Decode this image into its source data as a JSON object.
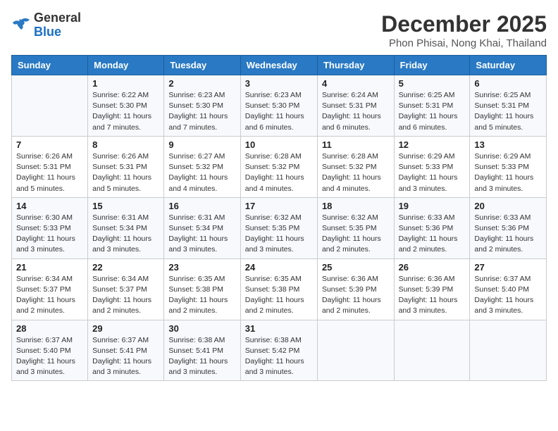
{
  "logo": {
    "general": "General",
    "blue": "Blue"
  },
  "title": "December 2025",
  "location": "Phon Phisai, Nong Khai, Thailand",
  "weekdays": [
    "Sunday",
    "Monday",
    "Tuesday",
    "Wednesday",
    "Thursday",
    "Friday",
    "Saturday"
  ],
  "weeks": [
    [
      {
        "day": "",
        "info": ""
      },
      {
        "day": "1",
        "info": "Sunrise: 6:22 AM\nSunset: 5:30 PM\nDaylight: 11 hours\nand 7 minutes."
      },
      {
        "day": "2",
        "info": "Sunrise: 6:23 AM\nSunset: 5:30 PM\nDaylight: 11 hours\nand 7 minutes."
      },
      {
        "day": "3",
        "info": "Sunrise: 6:23 AM\nSunset: 5:30 PM\nDaylight: 11 hours\nand 6 minutes."
      },
      {
        "day": "4",
        "info": "Sunrise: 6:24 AM\nSunset: 5:31 PM\nDaylight: 11 hours\nand 6 minutes."
      },
      {
        "day": "5",
        "info": "Sunrise: 6:25 AM\nSunset: 5:31 PM\nDaylight: 11 hours\nand 6 minutes."
      },
      {
        "day": "6",
        "info": "Sunrise: 6:25 AM\nSunset: 5:31 PM\nDaylight: 11 hours\nand 5 minutes."
      }
    ],
    [
      {
        "day": "7",
        "info": "Sunrise: 6:26 AM\nSunset: 5:31 PM\nDaylight: 11 hours\nand 5 minutes."
      },
      {
        "day": "8",
        "info": "Sunrise: 6:26 AM\nSunset: 5:31 PM\nDaylight: 11 hours\nand 5 minutes."
      },
      {
        "day": "9",
        "info": "Sunrise: 6:27 AM\nSunset: 5:32 PM\nDaylight: 11 hours\nand 4 minutes."
      },
      {
        "day": "10",
        "info": "Sunrise: 6:28 AM\nSunset: 5:32 PM\nDaylight: 11 hours\nand 4 minutes."
      },
      {
        "day": "11",
        "info": "Sunrise: 6:28 AM\nSunset: 5:32 PM\nDaylight: 11 hours\nand 4 minutes."
      },
      {
        "day": "12",
        "info": "Sunrise: 6:29 AM\nSunset: 5:33 PM\nDaylight: 11 hours\nand 3 minutes."
      },
      {
        "day": "13",
        "info": "Sunrise: 6:29 AM\nSunset: 5:33 PM\nDaylight: 11 hours\nand 3 minutes."
      }
    ],
    [
      {
        "day": "14",
        "info": "Sunrise: 6:30 AM\nSunset: 5:33 PM\nDaylight: 11 hours\nand 3 minutes."
      },
      {
        "day": "15",
        "info": "Sunrise: 6:31 AM\nSunset: 5:34 PM\nDaylight: 11 hours\nand 3 minutes."
      },
      {
        "day": "16",
        "info": "Sunrise: 6:31 AM\nSunset: 5:34 PM\nDaylight: 11 hours\nand 3 minutes."
      },
      {
        "day": "17",
        "info": "Sunrise: 6:32 AM\nSunset: 5:35 PM\nDaylight: 11 hours\nand 3 minutes."
      },
      {
        "day": "18",
        "info": "Sunrise: 6:32 AM\nSunset: 5:35 PM\nDaylight: 11 hours\nand 2 minutes."
      },
      {
        "day": "19",
        "info": "Sunrise: 6:33 AM\nSunset: 5:36 PM\nDaylight: 11 hours\nand 2 minutes."
      },
      {
        "day": "20",
        "info": "Sunrise: 6:33 AM\nSunset: 5:36 PM\nDaylight: 11 hours\nand 2 minutes."
      }
    ],
    [
      {
        "day": "21",
        "info": "Sunrise: 6:34 AM\nSunset: 5:37 PM\nDaylight: 11 hours\nand 2 minutes."
      },
      {
        "day": "22",
        "info": "Sunrise: 6:34 AM\nSunset: 5:37 PM\nDaylight: 11 hours\nand 2 minutes."
      },
      {
        "day": "23",
        "info": "Sunrise: 6:35 AM\nSunset: 5:38 PM\nDaylight: 11 hours\nand 2 minutes."
      },
      {
        "day": "24",
        "info": "Sunrise: 6:35 AM\nSunset: 5:38 PM\nDaylight: 11 hours\nand 2 minutes."
      },
      {
        "day": "25",
        "info": "Sunrise: 6:36 AM\nSunset: 5:39 PM\nDaylight: 11 hours\nand 2 minutes."
      },
      {
        "day": "26",
        "info": "Sunrise: 6:36 AM\nSunset: 5:39 PM\nDaylight: 11 hours\nand 3 minutes."
      },
      {
        "day": "27",
        "info": "Sunrise: 6:37 AM\nSunset: 5:40 PM\nDaylight: 11 hours\nand 3 minutes."
      }
    ],
    [
      {
        "day": "28",
        "info": "Sunrise: 6:37 AM\nSunset: 5:40 PM\nDaylight: 11 hours\nand 3 minutes."
      },
      {
        "day": "29",
        "info": "Sunrise: 6:37 AM\nSunset: 5:41 PM\nDaylight: 11 hours\nand 3 minutes."
      },
      {
        "day": "30",
        "info": "Sunrise: 6:38 AM\nSunset: 5:41 PM\nDaylight: 11 hours\nand 3 minutes."
      },
      {
        "day": "31",
        "info": "Sunrise: 6:38 AM\nSunset: 5:42 PM\nDaylight: 11 hours\nand 3 minutes."
      },
      {
        "day": "",
        "info": ""
      },
      {
        "day": "",
        "info": ""
      },
      {
        "day": "",
        "info": ""
      }
    ]
  ]
}
